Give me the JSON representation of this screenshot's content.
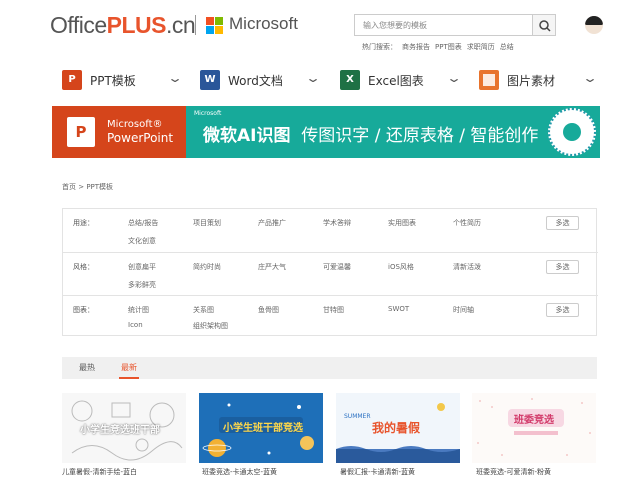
{
  "header": {
    "logo_office": "Office",
    "logo_plus": "PLUS",
    "logo_cn": ".cn",
    "ms_text": "Microsoft",
    "search_placeholder": "输入您想要的模板",
    "hot_label": "热门搜索：",
    "hot_items": [
      "商务报告",
      "PPT图表",
      "求职简历",
      "总结"
    ]
  },
  "nav": {
    "items": [
      {
        "icon": "P",
        "label": "PPT模板",
        "color": "#d5451b"
      },
      {
        "icon": "W",
        "label": "Word文档",
        "color": "#2a5699"
      },
      {
        "icon": "X",
        "label": "Excel图表",
        "color": "#1e7145"
      },
      {
        "icon": "",
        "label": "图片素材",
        "color": "#e8732c"
      }
    ]
  },
  "banner": {
    "pp_icon": "P",
    "pp_ms": "Microsoft®",
    "pp_name": "PowerPoint",
    "ms_small": "Microsoft",
    "title_bold": "微软AI识图",
    "title_rest": "传图识字 / 还原表格 / 智能创作"
  },
  "breadcrumb": "首页 > PPT模板",
  "filters": {
    "more_label": "多选",
    "rows": [
      {
        "label": "用途：",
        "options": [
          "总结/报告",
          "项目策划",
          "产品推广",
          "学术答辩",
          "实用图表",
          "个性简历"
        ],
        "options2": [
          "文化创意"
        ]
      },
      {
        "label": "风格：",
        "options": [
          "创意扁平",
          "简约时尚",
          "庄严大气",
          "可爱温馨",
          "iOS风格",
          "清新活泼"
        ],
        "options2": [
          "多彩鲜亮"
        ]
      },
      {
        "label": "图表：",
        "options": [
          "统计图",
          "关系图",
          "鱼骨图",
          "甘特图",
          "SWOT",
          "时间轴"
        ],
        "options2": [
          "Icon",
          "组织架构图"
        ]
      }
    ]
  },
  "tabs": {
    "items": [
      "最热",
      "最新"
    ]
  },
  "thumbnails": [
    {
      "caption": "儿童暑假-清新手绘-蓝白",
      "overlay": "小学生竞选班干部"
    },
    {
      "caption": "班委竞选-卡通太空-蓝黄",
      "overlay": "小学生班干部竞选"
    },
    {
      "caption": "暑假汇报-卡通清新-蓝黄",
      "overlay": "我的暑假",
      "overlay_small": "SUMMER"
    },
    {
      "caption": "班委竞选-可爱清新-粉黄",
      "overlay": "班委竞选"
    }
  ]
}
